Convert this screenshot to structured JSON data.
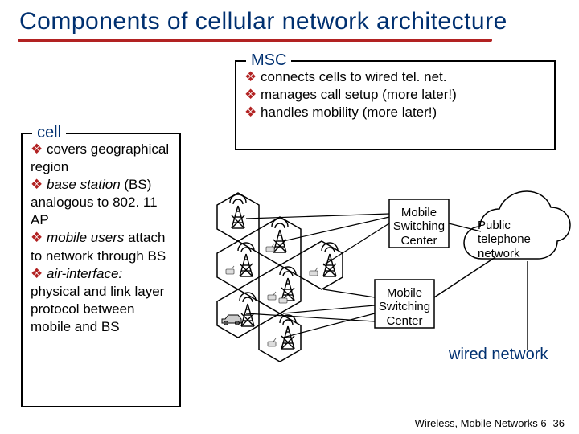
{
  "title": "Components of cellular network architecture",
  "msc": {
    "legend": "MSC",
    "items": [
      "connects cells to wired tel. net.",
      "manages call setup (more later!)",
      "handles mobility (more later!)"
    ]
  },
  "cell": {
    "legend": "cell",
    "lines": [
      {
        "bullet": true,
        "text": " covers geographical region"
      },
      {
        "bullet": true,
        "em": "base station",
        "text": " (BS) analogous to 802. 11 AP"
      },
      {
        "bullet": true,
        "em": "mobile users",
        "text": " attach to network through BS"
      },
      {
        "bullet": true,
        "em": "air-interface:",
        "text": " physical and link layer protocol between mobile and BS"
      }
    ]
  },
  "diagram_labels": {
    "msc1": "Mobile Switching Center",
    "msc2": "Mobile Switching Center",
    "public_net": "Public telephone network",
    "wired_net": "wired network"
  },
  "footer": "Wireless, Mobile Networks  6 -36"
}
